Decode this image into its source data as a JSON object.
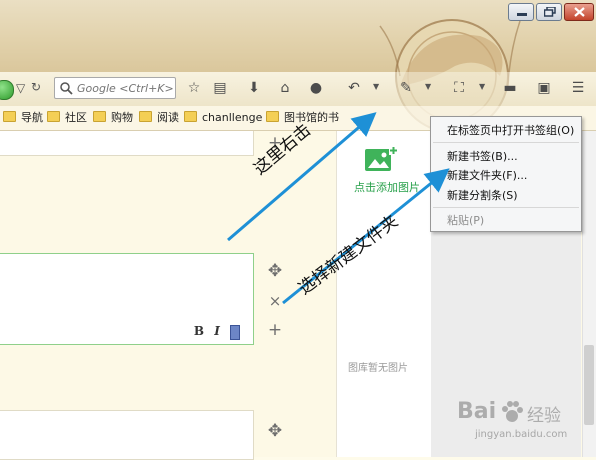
{
  "toolbar": {
    "search_placeholder": "Google <Ctrl+K>"
  },
  "bookmarks": [
    {
      "label": "导航"
    },
    {
      "label": "社区"
    },
    {
      "label": "购物"
    },
    {
      "label": "阅读"
    },
    {
      "label": "chanllenge"
    },
    {
      "label": "图书馆的书"
    }
  ],
  "editor": {
    "bold_label": "B",
    "italic_label": "I"
  },
  "panel": {
    "add_image_label": "点击添加图片",
    "no_image_label": "图库暂无图片"
  },
  "context_menu": {
    "items": [
      {
        "label": "在标签页中打开书签组(O)"
      },
      {
        "label": "新建书签(B)..."
      },
      {
        "label": "新建文件夹(F)..."
      },
      {
        "label": "新建分割条(S)"
      },
      {
        "label": "粘贴(P)"
      }
    ]
  },
  "annotations": {
    "right_click": "这里右击",
    "choose_new_folder": "选择新建文件夹"
  },
  "watermark": {
    "brand": "Bai",
    "brand_tail": "经验",
    "url": "jingyan.baidu.com"
  },
  "colors": {
    "arrow": "#1e90d6",
    "accent_green": "#27a04a",
    "card_border_active": "#8fd08a"
  }
}
